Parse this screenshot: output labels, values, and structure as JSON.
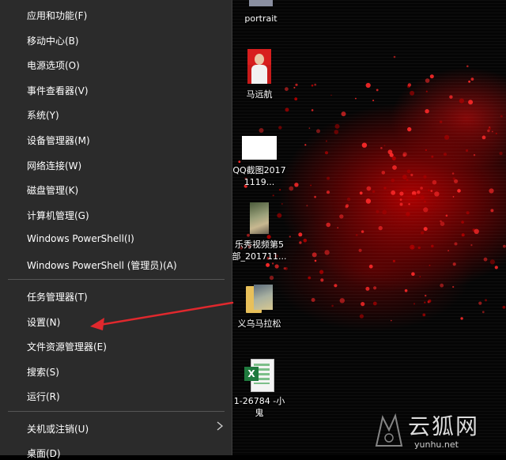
{
  "menu": {
    "items": [
      {
        "label": "应用和功能(F)"
      },
      {
        "label": "移动中心(B)"
      },
      {
        "label": "电源选项(O)"
      },
      {
        "label": "事件查看器(V)"
      },
      {
        "label": "系统(Y)"
      },
      {
        "label": "设备管理器(M)"
      },
      {
        "label": "网络连接(W)"
      },
      {
        "label": "磁盘管理(K)"
      },
      {
        "label": "计算机管理(G)"
      },
      {
        "label": "Windows PowerShell(I)"
      },
      {
        "label": "Windows PowerShell (管理员)(A)"
      },
      {
        "label": "任务管理器(T)"
      },
      {
        "label": "设置(N)"
      },
      {
        "label": "文件资源管理器(E)"
      },
      {
        "label": "搜索(S)"
      },
      {
        "label": "运行(R)"
      },
      {
        "label": "关机或注销(U)"
      },
      {
        "label": "桌面(D)"
      }
    ],
    "submenu_glyph": "›"
  },
  "desktop": {
    "icons": [
      {
        "label": "portrait"
      },
      {
        "label": "马远航"
      },
      {
        "label": "QQ截图20171119..."
      },
      {
        "label": "乐秀视频第5部_201711..."
      },
      {
        "label": "义乌马拉松"
      },
      {
        "label": "1-26784 -小鬼"
      }
    ]
  },
  "watermark": {
    "text": "云狐网",
    "url": "yunhu.net"
  },
  "colors": {
    "menu_bg": "#2b2b2b",
    "arrow": "#e0282d",
    "wallpaper_accent": "#c80000"
  }
}
